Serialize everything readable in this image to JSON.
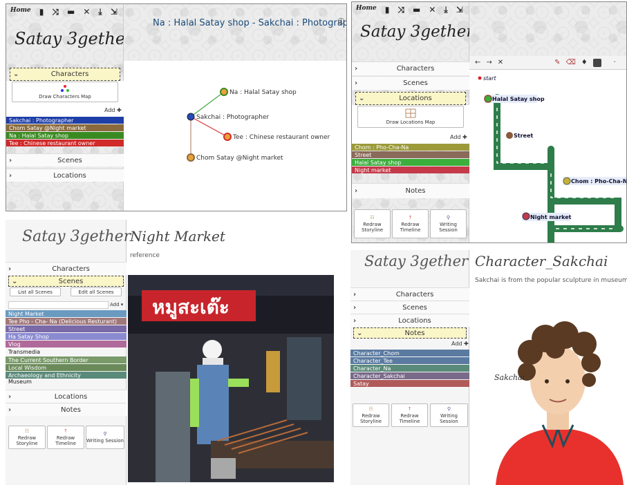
{
  "common": {
    "app_name": "Satay 3gether",
    "home_label": "Home",
    "add_label": "Add",
    "characters": "Characters",
    "scenes": "Scenes",
    "locations": "Locations",
    "notes": "Notes",
    "redraw_storyline": "Redraw Storyline",
    "redraw_timeline": "Redraw Timeline",
    "writing_session": "Writing Session"
  },
  "panel1": {
    "title": "Na : Halal Satay shop - Sakchai : Photographer",
    "draw_characters_map": "Draw Characters Map",
    "characters": [
      {
        "label": "Sakchai : Photographer",
        "color": "#1f3fa8"
      },
      {
        "label": "Chom Satay @Night market",
        "color": "#8a6a3c"
      },
      {
        "label": "Na : Halal Satay shop",
        "color": "#3a8a22"
      },
      {
        "label": "Tee : Chinese restaurant owner",
        "color": "#d12a2a"
      }
    ],
    "nodes": {
      "na": "Na : Halal Satay shop",
      "sakchai": "Sakchai : Photographer",
      "tee": "Tee : Chinese restaurant owner",
      "chom": "Chom Satay @Night market"
    }
  },
  "panel2": {
    "draw_locations_map": "Draw Locations Map",
    "locations": [
      {
        "label": "Chom : Pho-Cha-Na",
        "color": "#9c9a3a"
      },
      {
        "label": "Street",
        "color": "#8a6a5a"
      },
      {
        "label": "Halal Satay shop",
        "color": "#3cae3c"
      },
      {
        "label": "Night market",
        "color": "#c43a4a"
      }
    ],
    "map_labels": {
      "start": "start",
      "halal": "Halal Satay shop",
      "street": "Street",
      "chom": "Chom : Pho-Cha-Na",
      "night": "Night market"
    }
  },
  "panel3": {
    "title": "Night Market",
    "subtitle": "reference",
    "list_all_scenes": "List all Scenes",
    "edit_all_scenes": "Edit all Scenes",
    "groups": [
      {
        "label": "Night Market",
        "color": "#6a9ac0"
      },
      {
        "label": "Tee Pho - Cha- Na (Delicious Resturant)",
        "color": "#a0787a"
      },
      {
        "label": "Street",
        "color": "#7a6aa8"
      },
      {
        "label": "Ha Satay Shop",
        "color": "#8a8ad0"
      },
      {
        "label": "Vlog",
        "color": "#b06a9a"
      }
    ],
    "transmedia_label": "Transmedia",
    "transmedia": [
      {
        "label": "The Current Southern Border",
        "color": "#7a9a6a"
      },
      {
        "label": "Local Wisdom",
        "color": "#6a8a5a"
      },
      {
        "label": "Archaeology and Ethnicity",
        "color": "#5a8a7a"
      }
    ],
    "museum_label": "Museum",
    "sign_text": "หมูสะเต๊ะ"
  },
  "panel4": {
    "title": "Character_Sakchai",
    "description": "Sakchai is from the popular sculpture in museum.",
    "notes": [
      {
        "label": "Character_Chom",
        "color": "#5a7aa0"
      },
      {
        "label": "Character_Tee",
        "color": "#5a7aa0"
      },
      {
        "label": "Character_Na",
        "color": "#5a8a7a"
      },
      {
        "label": "Character_Sakchai",
        "color": "#7a6a8a"
      },
      {
        "label": "Satay",
        "color": "#b05a5a"
      }
    ],
    "signature": "Sakchai"
  }
}
